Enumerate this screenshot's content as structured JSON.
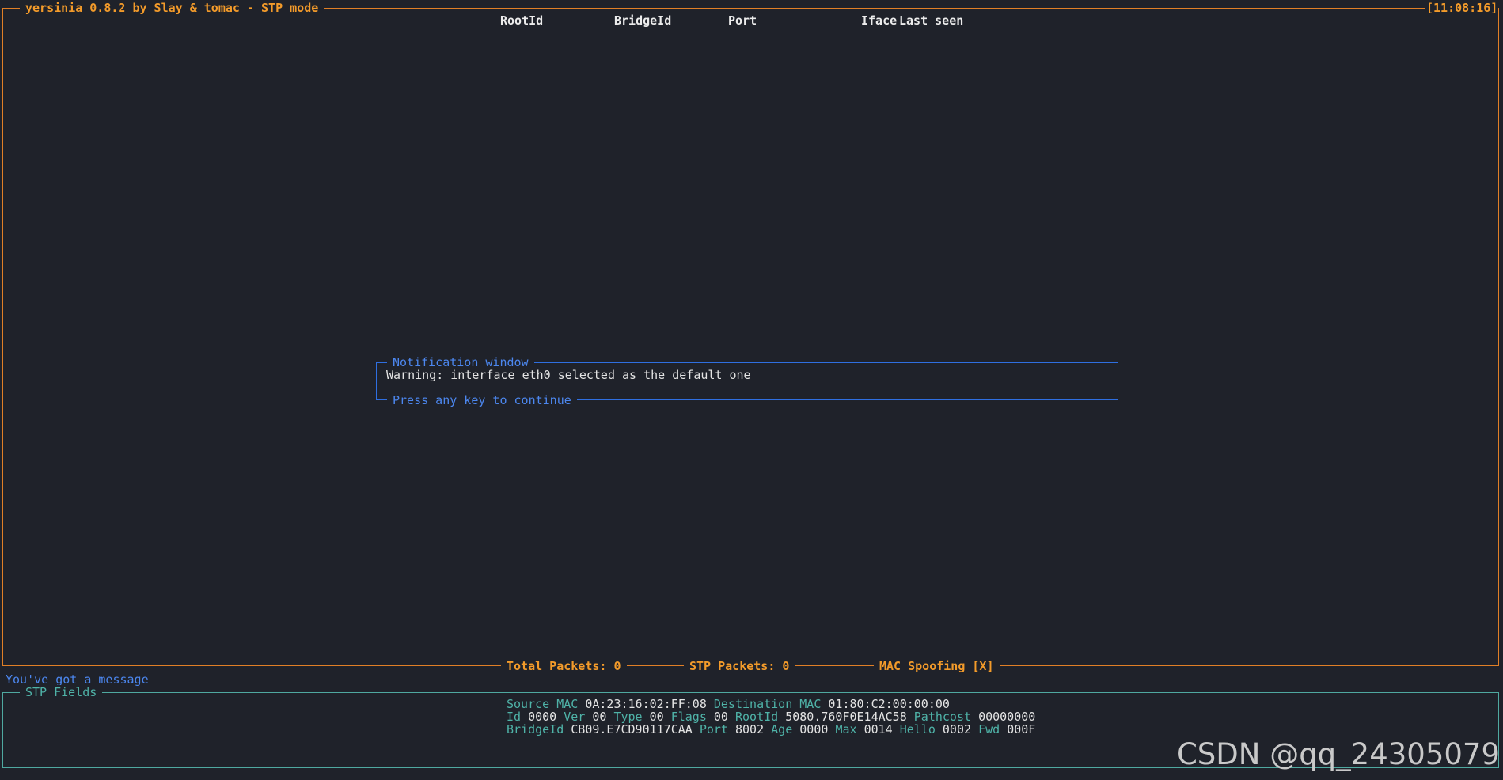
{
  "window": {
    "title": "yersinia 0.8.2 by Slay & tomac - STP mode",
    "clock": "[11:08:16]"
  },
  "table": {
    "columns": [
      "RootId",
      "BridgeId",
      "Port",
      "Iface",
      "Last seen"
    ]
  },
  "status_bar": {
    "total_packets": "Total Packets: 0",
    "stp_packets": "STP Packets: 0",
    "mac_spoofing": "MAC Spoofing [X]"
  },
  "notification": {
    "title": "Notification window",
    "message": "Warning: interface eth0 selected as the default one",
    "footer": "Press any key to continue"
  },
  "message_line": "You've got a message",
  "stp_fields": {
    "title": "STP Fields",
    "source_mac_label": "Source MAC",
    "source_mac": "0A:23:16:02:FF:08",
    "dest_mac_label": "Destination MAC",
    "dest_mac": "01:80:C2:00:00:00",
    "id_label": "Id",
    "id": "0000",
    "ver_label": "Ver",
    "ver": "00",
    "type_label": "Type",
    "type": "00",
    "flags_label": "Flags",
    "flags": "00",
    "rootid_label": "RootId",
    "rootid": "5080.760F0E14AC58",
    "pathcost_label": "Pathcost",
    "pathcost": "00000000",
    "bridgeid_label": "BridgeId",
    "bridgeid": "CB09.E7CD90117CAA",
    "port_label": "Port",
    "port": "8002",
    "age_label": "Age",
    "age": "0000",
    "max_label": "Max",
    "max": "0014",
    "hello_label": "Hello",
    "hello": "0002",
    "fwd_label": "Fwd",
    "fwd": "000F"
  },
  "watermark": "CSDN @qq_24305079",
  "colors": {
    "background": "#1f222a",
    "accent_orange": "#f39b2a",
    "notification_blue": "#4c87ef",
    "fields_teal": "#4fb3a8"
  }
}
